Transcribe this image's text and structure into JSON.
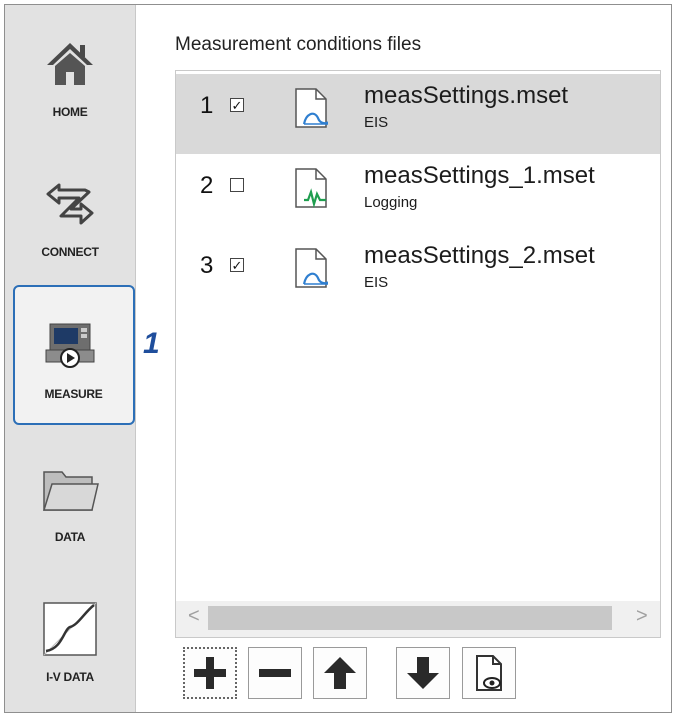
{
  "sidebar": {
    "items": [
      {
        "label": "HOME",
        "icon": "home-icon"
      },
      {
        "label": "CONNECT",
        "icon": "connect-icon"
      },
      {
        "label": "MEASURE",
        "icon": "measure-icon",
        "active": true
      },
      {
        "label": "DATA",
        "icon": "folder-icon"
      },
      {
        "label": "I-V DATA",
        "icon": "iv-curve-icon"
      }
    ]
  },
  "callout": "1",
  "panel": {
    "title": "Measurement conditions files",
    "files": [
      {
        "num": "1",
        "checked": true,
        "name": "measSettings.mset",
        "type": "EIS",
        "icon": "eis-file-icon",
        "selected": true
      },
      {
        "num": "2",
        "checked": false,
        "name": "measSettings_1.mset",
        "type": "Logging",
        "icon": "logging-file-icon",
        "selected": false
      },
      {
        "num": "3",
        "checked": true,
        "name": "measSettings_2.mset",
        "type": "EIS",
        "icon": "eis-file-icon",
        "selected": false
      }
    ]
  },
  "scrollbar": {
    "left_arrow": "<",
    "right_arrow": ">"
  },
  "toolbar": {
    "buttons": [
      {
        "name": "add-button",
        "icon": "plus-icon"
      },
      {
        "name": "remove-button",
        "icon": "minus-icon"
      },
      {
        "name": "move-up-button",
        "icon": "arrow-up-icon"
      },
      {
        "name": "move-down-button",
        "icon": "arrow-down-icon"
      },
      {
        "name": "preview-button",
        "icon": "file-preview-icon"
      }
    ]
  },
  "colors": {
    "accent": "#2c6fb7",
    "callout": "#1f4e9c",
    "eis": "#2f7fd0",
    "logging": "#1f9e4f",
    "selected_row": "#d9d9d9",
    "sidebar": "#e2e2e2"
  }
}
